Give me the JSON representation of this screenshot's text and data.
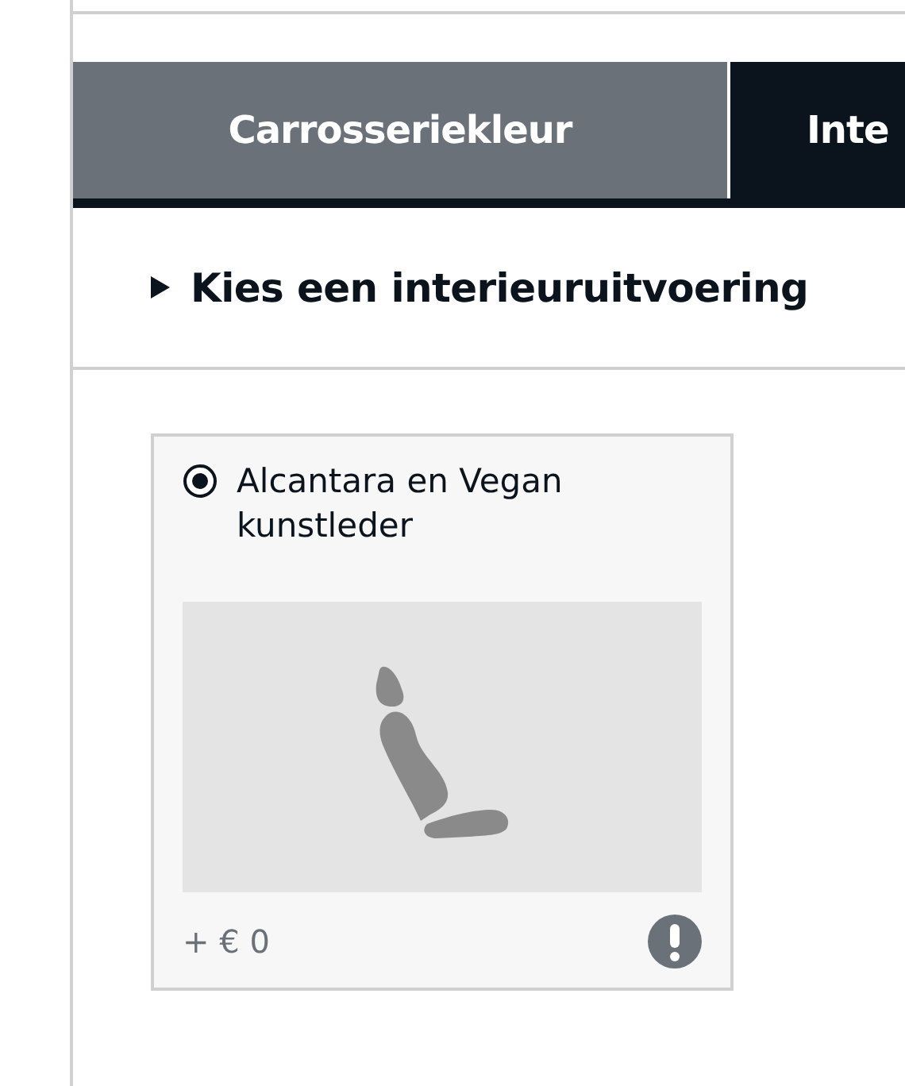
{
  "tabs": [
    {
      "label": "Carrosseriekleur",
      "selected": false
    },
    {
      "label": "Inte",
      "selected": true
    }
  ],
  "section": {
    "title": "Kies een interieuruitvoering",
    "expanded": false
  },
  "options": [
    {
      "label": "Alcantara en Vegan kunstleder",
      "selected": true,
      "price": "+ € 0",
      "kind": "picture"
    }
  ]
}
